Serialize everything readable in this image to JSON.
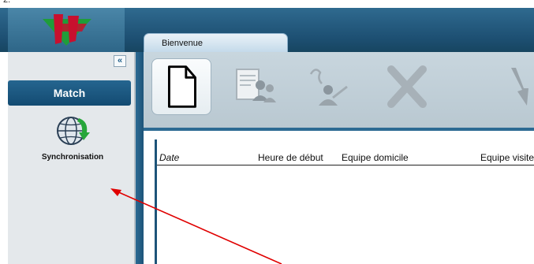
{
  "stray_mark": "2.",
  "tabs": [
    {
      "label": "Bienvenue"
    }
  ],
  "sidebar": {
    "collapse_glyph": "«",
    "section_button": "Match",
    "items": [
      {
        "label": "Synchronisation",
        "icon": "globe-sync-icon"
      }
    ]
  },
  "toolbar": {
    "buttons": [
      {
        "icon": "new-document-icon",
        "state": "active"
      },
      {
        "icon": "document-users-icon",
        "state": "disabled"
      },
      {
        "icon": "user-edit-icon",
        "state": "disabled"
      },
      {
        "icon": "delete-x-icon",
        "state": "disabled"
      },
      {
        "icon": "sync-arrow-icon",
        "state": "disabled"
      }
    ]
  },
  "grid": {
    "columns": [
      "Date",
      "Heure de début",
      "Equipe domicile",
      "Equipe visiteur"
    ],
    "rows": []
  },
  "annotation": {
    "color": "#e00000",
    "target": "sync-item"
  },
  "colors": {
    "header_blue": "#1d4f72",
    "accent_blue": "#134b72",
    "toolbar_bg": "#c8d6de"
  }
}
